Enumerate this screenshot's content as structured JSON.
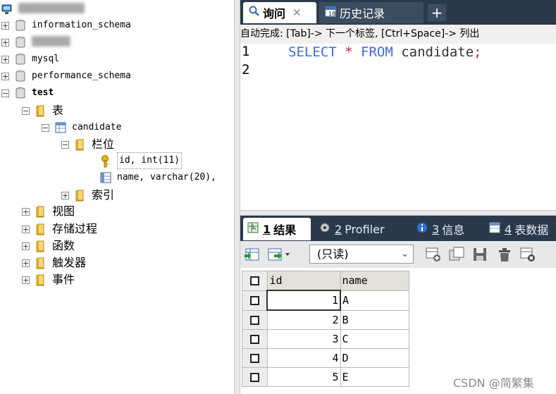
{
  "tree": {
    "connection_label": "",
    "databases": [
      {
        "label": "information_schema"
      },
      {
        "label": ""
      },
      {
        "label": "mysql"
      },
      {
        "label": "performance_schema"
      },
      {
        "label": "test"
      }
    ],
    "tables_folder": "表",
    "table_name": "candidate",
    "columns_folder": "栏位",
    "columns": [
      "id, int(11)",
      "name, varchar(20),"
    ],
    "indexes_folder": "索引",
    "other_folders": [
      "视图",
      "存储过程",
      "函数",
      "触发器",
      "事件"
    ]
  },
  "editor_tabs": {
    "query_tab": "询问",
    "history_tab": "历史记录",
    "new_tab": "+"
  },
  "autocomplete_hint": "自动完成: [Tab]-> 下一个标签, [Ctrl+Space]-> 列出",
  "editor": {
    "line_numbers": [
      "1",
      "2"
    ],
    "sql": {
      "kw1": "SELECT",
      "star": "*",
      "kw2": "FROM",
      "table": "candidate",
      "semi": ";"
    }
  },
  "result_tabs": [
    {
      "num": "1",
      "label": "结果"
    },
    {
      "num": "2",
      "label": "Profiler"
    },
    {
      "num": "3",
      "label": "信息"
    },
    {
      "num": "4",
      "label": "表数据"
    }
  ],
  "readonly_select": "(只读)",
  "grid": {
    "headers": [
      "id",
      "name"
    ],
    "rows": [
      {
        "id": "1",
        "name": "A"
      },
      {
        "id": "2",
        "name": "B"
      },
      {
        "id": "3",
        "name": "C"
      },
      {
        "id": "4",
        "name": "D"
      },
      {
        "id": "5",
        "name": "E"
      }
    ]
  },
  "watermark": "CSDN @简繁集",
  "colors": {
    "tab_bar": "#2b3a4a",
    "keyword": "#4169d8",
    "operator": "#c12060"
  }
}
